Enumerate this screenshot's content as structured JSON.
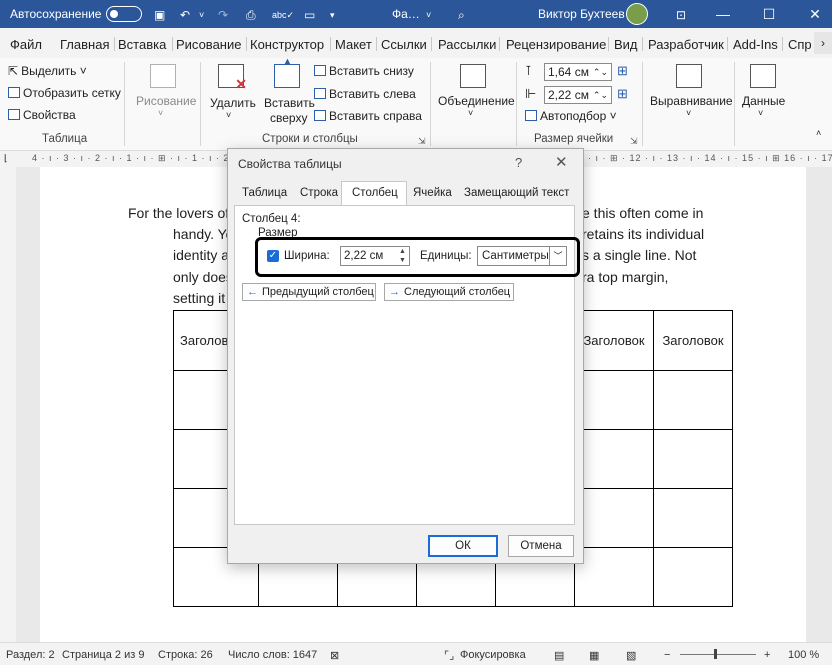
{
  "titlebar": {
    "autosave_label": "Автосохранение",
    "autosave_state": "Откл.",
    "doc_name": "Фа…",
    "user_name": "Виктор Бухтеев"
  },
  "menu": {
    "tabs": [
      "Файл",
      "Главная",
      "Вставка",
      "Рисование",
      "Конструктор",
      "Макет",
      "Ссылки",
      "Рассылки",
      "Рецензирование",
      "Вид",
      "Разработчик",
      "Add-Ins",
      "Спр"
    ]
  },
  "ribbon": {
    "table_group": {
      "select": "Выделить ˅",
      "gridlines": "Отобразить сетку",
      "properties": "Свойства",
      "label": "Таблица"
    },
    "drawing": "Рисование",
    "delete": "Удалить",
    "insert_above": [
      "Вставить",
      "сверху"
    ],
    "insert_below": "Вставить снизу",
    "insert_left": "Вставить слева",
    "insert_right": "Вставить справа",
    "rows_cols_label": "Строки и столбцы",
    "merge": "Объединение",
    "height_value": "1,64 см",
    "width_value": "2,22 см",
    "autofit": "Автоподбор ˅",
    "cell_size_label": "Размер ячейки",
    "alignment": "Выравнивание",
    "data": "Данные"
  },
  "ruler": {
    "scale": "4 · ı · 3 · ı · 2 · ı · 1 · ı · ⊞ · ı · 1 · ı · 2 · ı · 3 ·",
    "scale_right": "· ı · ⊞ · 12 · ı · 13 · ı · 14 · ı · 15 · ı ⊞ 16 · ı · 17 · ı"
  },
  "document": {
    "lines": [
      "For the lovers of",
      "handy. Yo",
      "identity a",
      "only does",
      "setting it"
    ],
    "lines_right": [
      "e this often come in",
      "retains its individual",
      "s a single line. Not",
      "ra top margin,"
    ],
    "table_header_left": "Заголов",
    "table_header_right1": "Заголовок",
    "table_header_right2": "Заголовок"
  },
  "dialog": {
    "title": "Свойства таблицы",
    "help": "?",
    "close": "✕",
    "tabs": [
      "Таблица",
      "Строка",
      "Столбец",
      "Ячейка",
      "Замещающий текст"
    ],
    "active_tab": "Столбец",
    "column_label": "Столбец 4:",
    "size_label": "Размер",
    "width_label": "Ширина:",
    "width_value": "2,22 см",
    "units_label": "Единицы:",
    "units_value": "Сантиметры",
    "prev_column": "Предыдущий столбец",
    "next_column": "Следующий столбец",
    "ok": "ОК",
    "cancel": "Отмена"
  },
  "status": {
    "section": "Раздел: 2",
    "page": "Страница 2 из 9",
    "line": "Строка: 26",
    "words": "Число слов: 1647",
    "focus": "Фокусировка",
    "zoom": "100 %"
  }
}
